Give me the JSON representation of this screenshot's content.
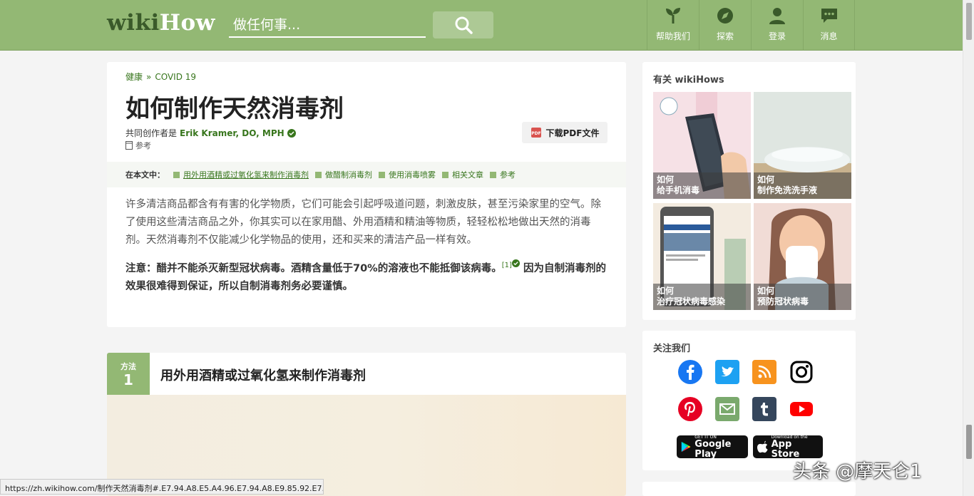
{
  "header": {
    "logo_wiki": "wiki",
    "logo_how": "How",
    "search_placeholder": "做任何事...",
    "nav": [
      {
        "label": "帮助我们",
        "icon": "sprout-icon"
      },
      {
        "label": "探索",
        "icon": "compass-icon"
      },
      {
        "label": "登录",
        "icon": "user-icon"
      },
      {
        "label": "消息",
        "icon": "chat-icon"
      }
    ]
  },
  "article": {
    "breadcrumb": [
      "健康",
      "»",
      "COVID 19"
    ],
    "title": "如何制作天然消毒剂",
    "coauthor_prefix": "共同创作者是",
    "coauthor_name": "Erik Kramer, DO, MPH",
    "refs_label": "参考",
    "pdf_label": "下载PDF文件",
    "toc_lead": "在本文中：",
    "toc_items": [
      "用外用酒精或过氧化氢来制作消毒剂",
      "做醋制消毒剂",
      "使用消毒喷雾",
      "相关文章",
      "参考"
    ],
    "intro": "许多清洁商品都含有有害的化学物质，它们可能会引起呼吸道问题，刺激皮肤，甚至污染家里的空气。除了使用这些清洁商品之外，你其实可以在家用醋、外用酒精和精油等物质，轻轻松松地做出天然的消毒剂。天然消毒剂不仅能减少化学物品的使用，还和买来的清洁产品一样有效。",
    "note_a": "注意：醋并不能杀灭新型冠状病毒。酒精含量低于70%的溶液也不能抵御该病毒。",
    "note_ref": "[1]",
    "note_b": " 因为自制消毒剂的效果很难得到保证，所以自制消毒剂务必要谨慎。"
  },
  "method": {
    "label": "方法",
    "number": "1",
    "title": "用外用酒精或过氧化氢来制作消毒剂"
  },
  "sidebar": {
    "related_heading": "有关 wikiHows",
    "related": [
      {
        "how": "如何",
        "title": "给手机消毒"
      },
      {
        "how": "如何",
        "title": "制作免洗洗手液"
      },
      {
        "how": "如何",
        "title": "治疗冠状病毒感染"
      },
      {
        "how": "如何",
        "title": "预防冠状病毒"
      }
    ],
    "follow_heading": "关注我们",
    "social": [
      "facebook-icon",
      "twitter-icon",
      "rss-icon",
      "instagram-icon",
      "pinterest-icon",
      "email-icon",
      "tumblr-icon",
      "youtube-icon"
    ],
    "google_play_small": "GET IT ON",
    "google_play_big": "Google Play",
    "app_store_small": "Download on the",
    "app_store_big": "App Store"
  },
  "status_url": "https://zh.wikihow.com/制作天然消毒剂#.E7.94.A8.E5.A4.96.E7.94.A8.E9.85.92.E7.B...",
  "watermark": "头条 @摩天仑1"
}
